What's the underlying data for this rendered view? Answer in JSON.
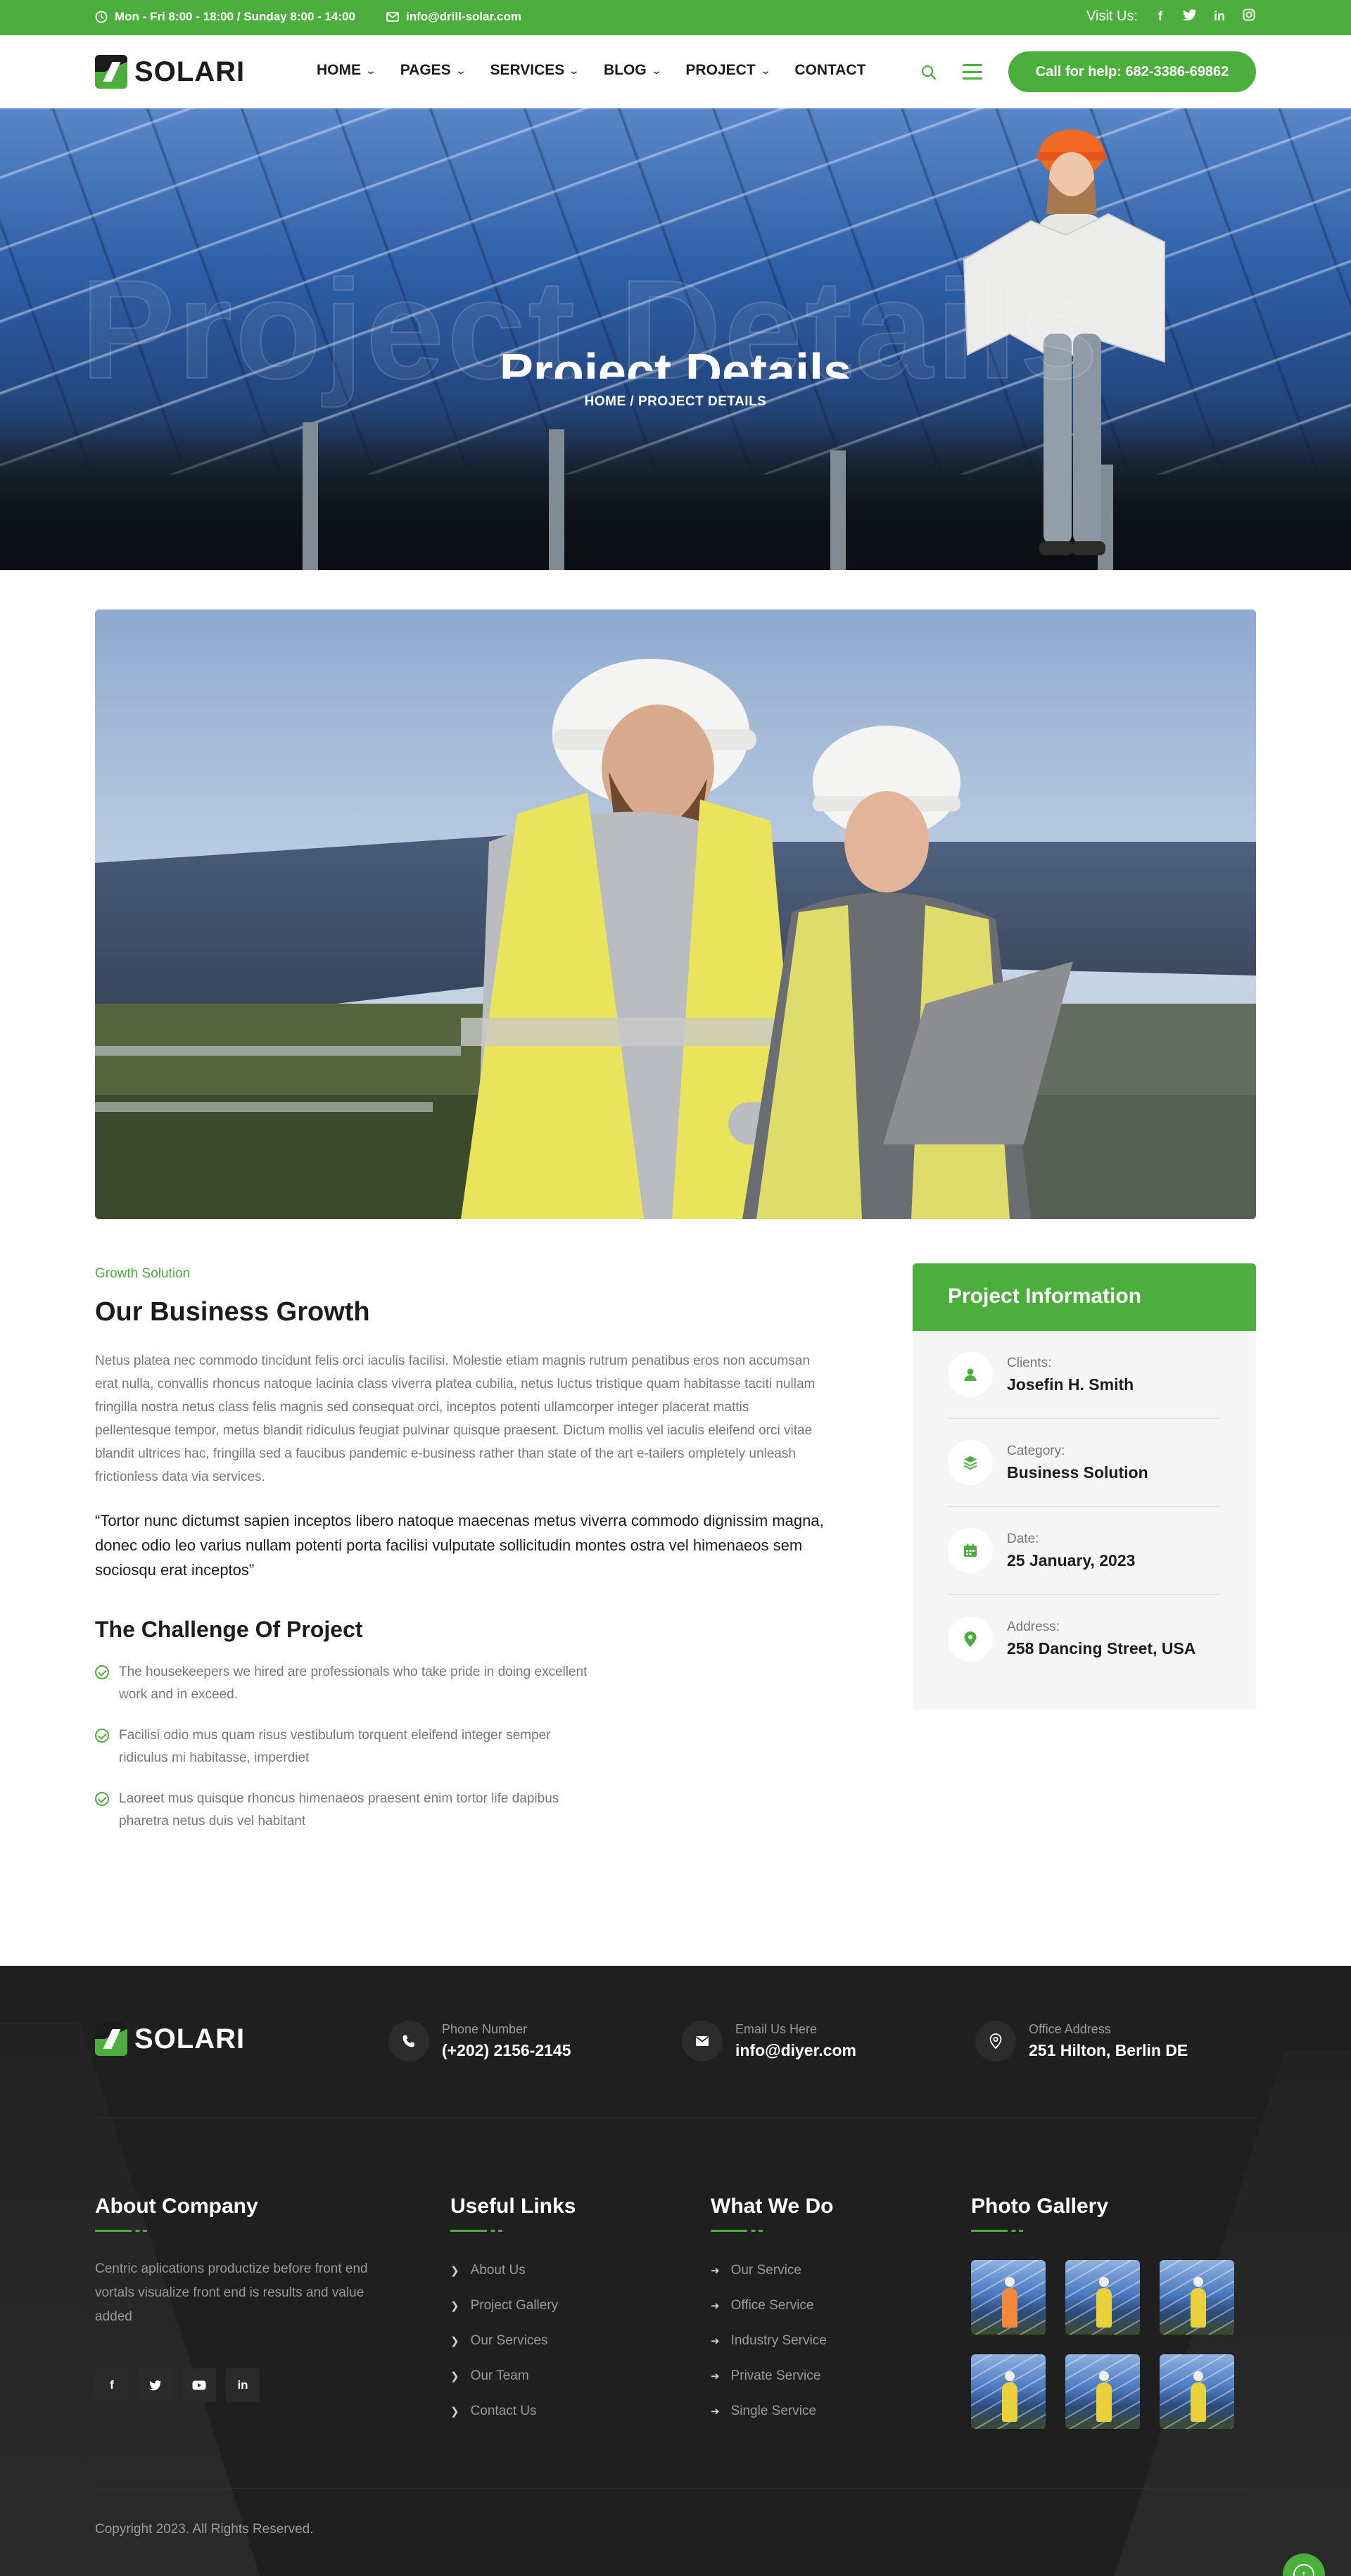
{
  "topbar": {
    "hours": "Mon - Fri 8:00 - 18:00 / Sunday 8:00 - 14:00",
    "email": "info@drill-solar.com",
    "visit_label": "Visit Us:",
    "social": [
      {
        "icon": "facebook-icon",
        "glyph": "f"
      },
      {
        "icon": "twitter-icon",
        "glyph": "𝕥"
      },
      {
        "icon": "linkedin-icon",
        "glyph": "in"
      },
      {
        "icon": "instagram-icon",
        "glyph": "◎"
      }
    ]
  },
  "header": {
    "logo_text": "SOLARI",
    "nav": [
      {
        "label": "HOME",
        "dropdown": true
      },
      {
        "label": "PAGES",
        "dropdown": true
      },
      {
        "label": "SERVICES",
        "dropdown": true
      },
      {
        "label": "BLOG",
        "dropdown": true
      },
      {
        "label": "PROJECT",
        "dropdown": true
      },
      {
        "label": "CONTACT",
        "dropdown": false
      }
    ],
    "cta": "Call for help: 682-3386-69862"
  },
  "hero": {
    "watermark": "Project Details",
    "title": "Project Details",
    "breadcrumb": "HOME / PROJECT DETAILS"
  },
  "content": {
    "tag": "Growth Solution",
    "heading": "Our Business Growth",
    "paragraph": "Netus platea nec commodo tincidunt felis orci iaculis facilisi. Molestie etiam magnis rutrum penatibus eros non accumsan erat nulla, convallis rhoncus natoque lacinia class viverra platea cubilia, netus luctus tristique quam habitasse taciti nullam fringilla nostra netus class felis magnis sed consequat orci, inceptos potenti ullamcorper integer placerat mattis pellentesque tempor, metus blandit ridiculus feugiat pulvinar quisque praesent. Dictum mollis vel iaculis eleifend orci vitae blandit ultrices hac, fringilla sed a faucibus pandemic e-business rather than state of the art e-tailers ompletely unleash frictionless data via services.",
    "quote": "“Tortor nunc dictumst sapien inceptos libero natoque maecenas metus viverra commodo dignissim magna, donec odio leo varius nullam potenti porta facilisi vulputate sollicitudin montes ostra vel himenaeos sem sociosqu erat inceptos”",
    "challenge_heading": "The Challenge Of Project",
    "checks": [
      "The housekeepers we hired are professionals who take pride in doing excellent work and in exceed.",
      "Facilisi odio mus quam risus vestibulum torquent eleifend integer semper ridiculus mi habitasse, imperdiet",
      "Laoreet mus quisque rhoncus himenaeos praesent enim tortor life dapibus pharetra netus duis vel habitant"
    ]
  },
  "info": {
    "title": "Project Information",
    "rows": [
      {
        "icon": "user-icon",
        "label": "Clients:",
        "value": "Josefin H. Smith"
      },
      {
        "icon": "layers-icon",
        "label": "Category:",
        "value": "Business Solution"
      },
      {
        "icon": "calendar-icon",
        "label": "Date:",
        "value": "25 January, 2023"
      },
      {
        "icon": "location-pin-icon",
        "label": "Address:",
        "value": "258 Dancing Street, USA"
      }
    ]
  },
  "footer": {
    "logo_text": "SOLARI",
    "contacts": [
      {
        "icon": "phone-icon",
        "label": "Phone Number",
        "value": "(+202) 2156-2145"
      },
      {
        "icon": "envelope-icon",
        "label": "Email Us Here",
        "value": "info@diyer.com"
      },
      {
        "icon": "location-pin-icon",
        "label": "Office Address",
        "value": "251 Hilton, Berlin DE"
      }
    ],
    "about": {
      "title": "About Company",
      "text": "Centric aplications productize before front end vortals visualize front end is results and value added",
      "social": [
        {
          "icon": "facebook-icon",
          "glyph": "f"
        },
        {
          "icon": "twitter-icon",
          "glyph": "𝕥"
        },
        {
          "icon": "youtube-icon",
          "glyph": "▶"
        },
        {
          "icon": "linkedin-icon",
          "glyph": "in"
        }
      ]
    },
    "useful_links": {
      "title": "Useful Links",
      "items": [
        "About Us",
        "Project Gallery",
        "Our Services",
        "Our Team",
        "Contact Us"
      ]
    },
    "what_we_do": {
      "title": "What We Do",
      "items": [
        "Our Service",
        "Office Service",
        "Industry Service",
        "Private Service",
        "Single Service"
      ]
    },
    "gallery": {
      "title": "Photo Gallery",
      "count": 6
    },
    "copyright": "Copyright 2023. All Rights Reserved."
  },
  "colors": {
    "brand_green": "#4cae3c",
    "dark": "#1c1c1c",
    "footer_bg": "#1f1f1f",
    "muted": "#777777"
  }
}
